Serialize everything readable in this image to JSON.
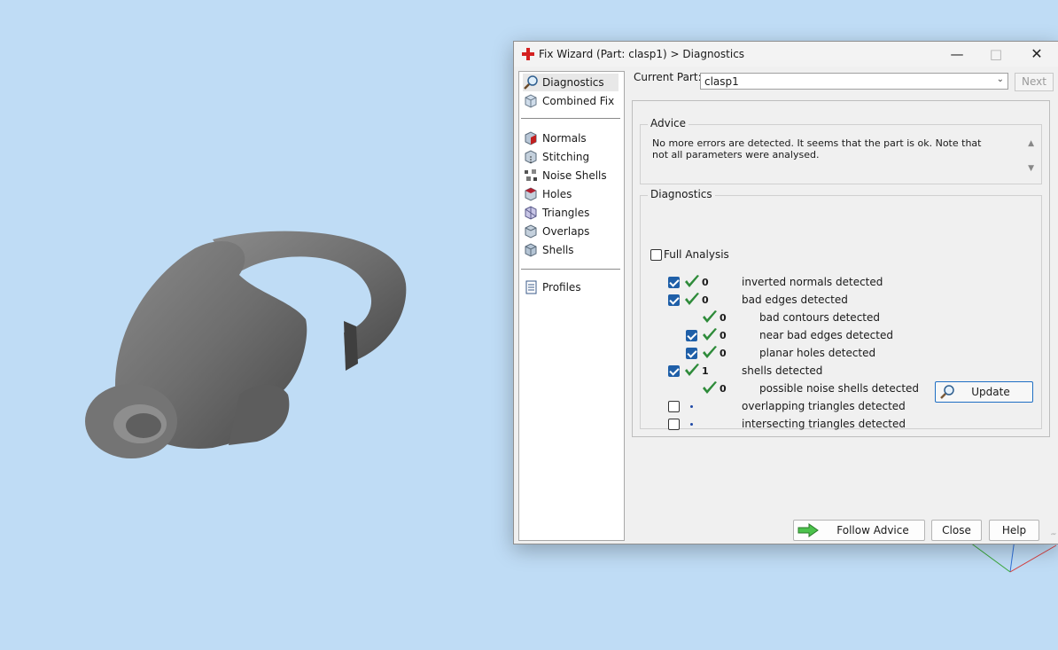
{
  "window": {
    "title": "Fix Wizard (Part: clasp1) > Diagnostics",
    "app_icon": "red-cross-icon",
    "controls": [
      "minimize",
      "maximize",
      "close"
    ]
  },
  "nav": {
    "group1": [
      {
        "label": "Diagnostics",
        "icon": "magnifier-icon",
        "selected": true
      },
      {
        "label": "Combined Fix",
        "icon": "cube-icon"
      }
    ],
    "group2": [
      {
        "label": "Normals",
        "icon": "normals-cube-icon"
      },
      {
        "label": "Stitching",
        "icon": "stitching-cube-icon"
      },
      {
        "label": "Noise Shells",
        "icon": "noise-shells-icon"
      },
      {
        "label": "Holes",
        "icon": "holes-cube-icon"
      },
      {
        "label": "Triangles",
        "icon": "triangles-cube-icon"
      },
      {
        "label": "Overlaps",
        "icon": "overlaps-cube-icon"
      },
      {
        "label": "Shells",
        "icon": "shells-cube-icon"
      }
    ],
    "group3": [
      {
        "label": "Profiles",
        "icon": "document-icon"
      }
    ]
  },
  "current_part": {
    "label": "Current Part:",
    "value": "clasp1",
    "next_label": "Next"
  },
  "advice": {
    "title": "Advice",
    "text": "No more errors are detected. It seems that the part is ok. Note that not all parameters were analysed."
  },
  "diagnostics": {
    "title": "Diagnostics",
    "full_analysis_label": "Full Analysis",
    "full_analysis_checked": false,
    "rows": [
      {
        "checked": true,
        "has_checkbox": true,
        "status": "ok",
        "count": "0",
        "label": "inverted normals detected",
        "indent": 0
      },
      {
        "checked": true,
        "has_checkbox": true,
        "status": "ok",
        "count": "0",
        "label": "bad edges detected",
        "indent": 0
      },
      {
        "checked": false,
        "has_checkbox": false,
        "status": "ok",
        "count": "0",
        "label": "bad contours detected",
        "indent": 1
      },
      {
        "checked": true,
        "has_checkbox": true,
        "status": "ok",
        "count": "0",
        "label": "near bad edges detected",
        "indent": 1
      },
      {
        "checked": true,
        "has_checkbox": true,
        "status": "ok",
        "count": "0",
        "label": "planar holes detected",
        "indent": 1
      },
      {
        "checked": true,
        "has_checkbox": true,
        "status": "ok",
        "count": "1",
        "label": "shells detected",
        "indent": 0
      },
      {
        "checked": false,
        "has_checkbox": false,
        "status": "ok",
        "count": "0",
        "label": "possible noise shells detected",
        "indent": 1
      },
      {
        "checked": false,
        "has_checkbox": true,
        "status": "pending",
        "count": "",
        "label": "overlapping triangles detected",
        "indent": 0
      },
      {
        "checked": false,
        "has_checkbox": true,
        "status": "pending",
        "count": "",
        "label": "intersecting triangles detected",
        "indent": 0
      }
    ],
    "update_label": "Update"
  },
  "buttons": {
    "follow_advice": "Follow Advice",
    "close": "Close",
    "help": "Help"
  },
  "colors": {
    "viewport_bg": "#bfdcf5",
    "check_green": "#2e8b3a",
    "checkbox_blue": "#1f5fa8",
    "model_gray": "#6f6f6f"
  }
}
